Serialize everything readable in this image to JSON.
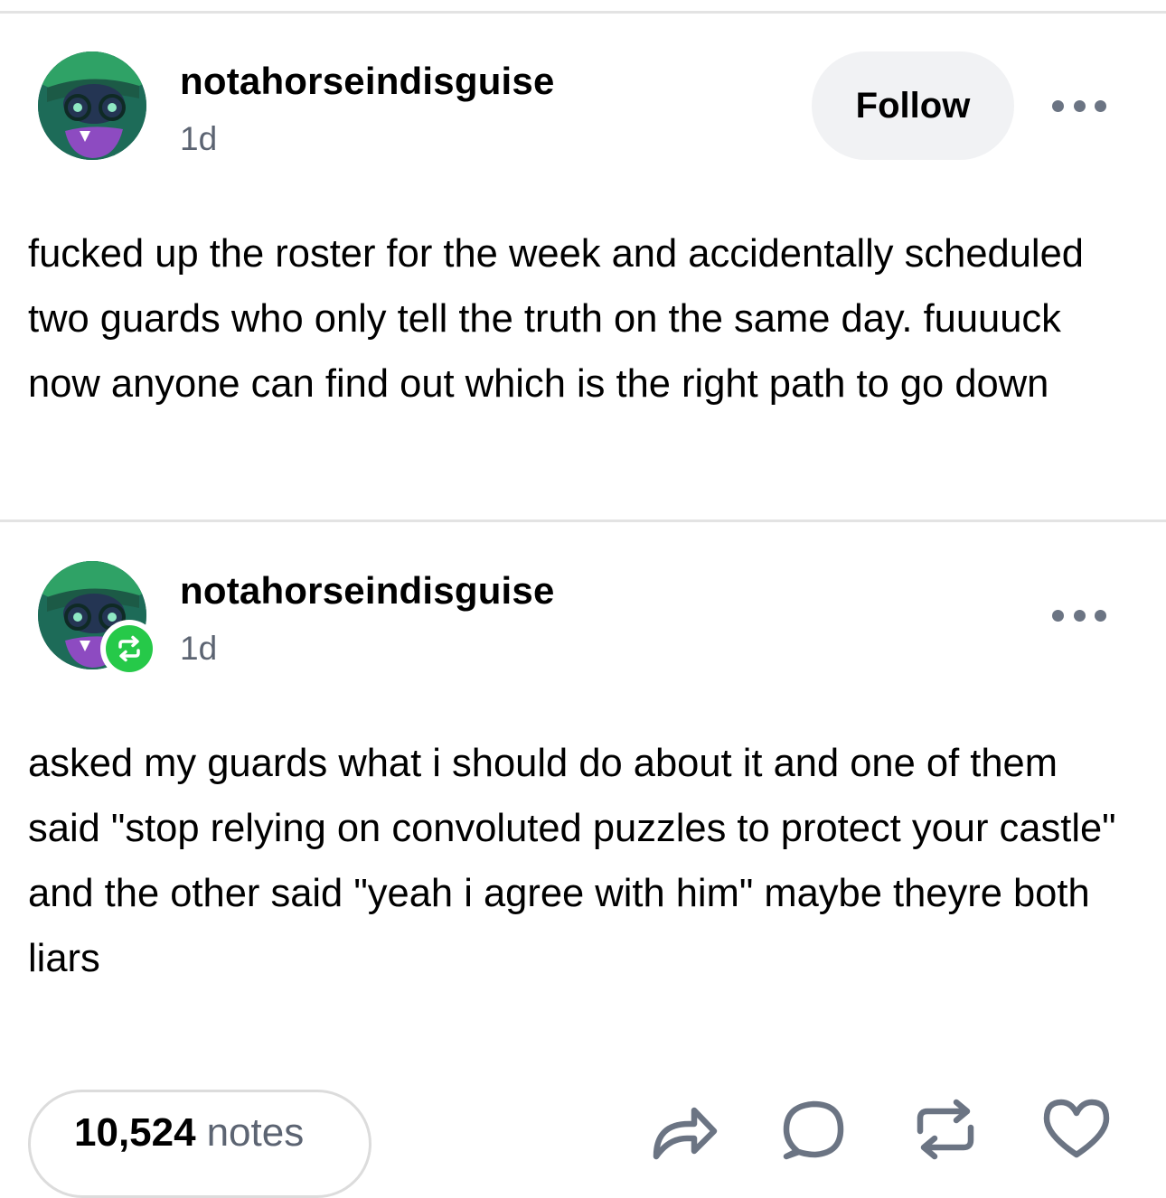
{
  "posts": [
    {
      "username": "notahorseindisguise",
      "time": "1d",
      "follow_label": "Follow",
      "text": "fucked up the roster for the week and accidentally scheduled two guards who only tell the truth on the same day. fuuuuck now anyone can find out which is the right path to go down"
    },
    {
      "username": "notahorseindisguise",
      "time": "1d",
      "reblog_badge_icon": "reblog-icon",
      "text": "asked my guards what i should do about it and one of them said \"stop relying on convoluted puzzles to protect your castle\" and the other said \"yeah i agree with him\" maybe theyre both liars"
    }
  ],
  "footer": {
    "notes_count": "10,524",
    "notes_label": "notes",
    "actions": [
      "share-icon",
      "reply-icon",
      "reblog-icon",
      "like-icon"
    ]
  },
  "colors": {
    "reblog_green": "#26c949",
    "muted_text": "#5c6472",
    "follow_bg": "#f1f2f4",
    "divider": "#e3e3e3"
  }
}
